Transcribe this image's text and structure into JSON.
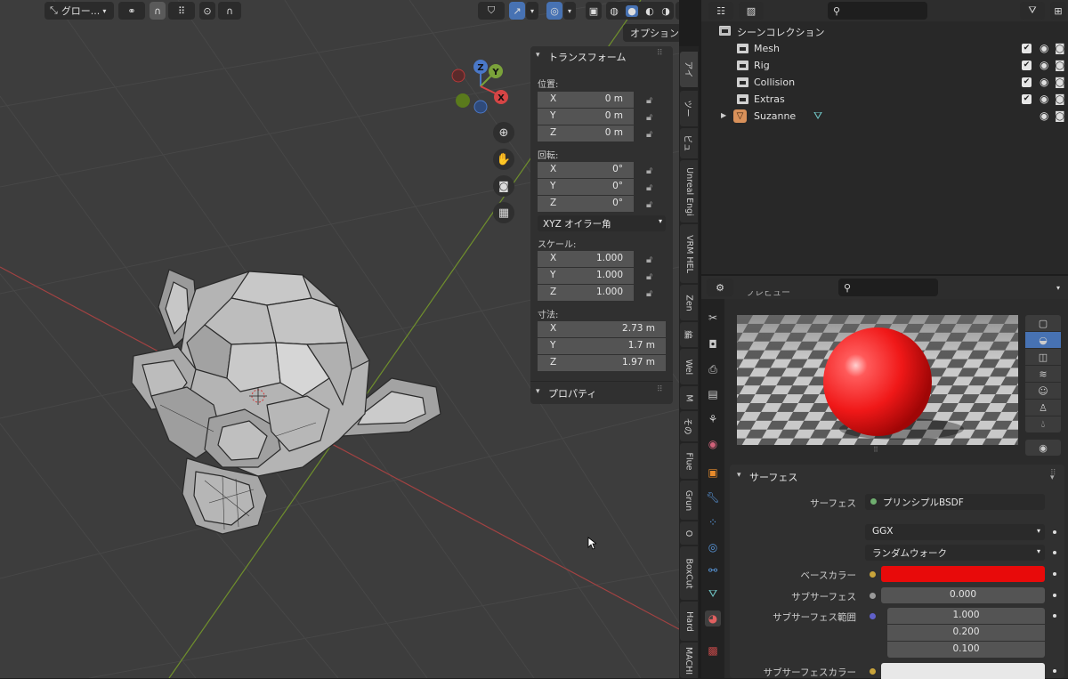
{
  "viewport": {
    "header": {
      "orientation_label": "グロー...",
      "options_label": "オプション"
    },
    "gizmo": {
      "z": "Z",
      "y": "Y",
      "x": "X"
    }
  },
  "npanel": {
    "transform_title": "トランスフォーム",
    "location_label": "位置:",
    "location": [
      {
        "axis": "X",
        "value": "0 m"
      },
      {
        "axis": "Y",
        "value": "0 m"
      },
      {
        "axis": "Z",
        "value": "0 m"
      }
    ],
    "rotation_label": "回転:",
    "rotation": [
      {
        "axis": "X",
        "value": "0°"
      },
      {
        "axis": "Y",
        "value": "0°"
      },
      {
        "axis": "Z",
        "value": "0°"
      }
    ],
    "rotation_mode": "XYZ オイラー角",
    "scale_label": "スケール:",
    "scale": [
      {
        "axis": "X",
        "value": "1.000"
      },
      {
        "axis": "Y",
        "value": "1.000"
      },
      {
        "axis": "Z",
        "value": "1.000"
      }
    ],
    "dimensions_label": "寸法:",
    "dimensions": [
      {
        "axis": "X",
        "value": "2.73 m"
      },
      {
        "axis": "Y",
        "value": "1.7 m"
      },
      {
        "axis": "Z",
        "value": "1.97 m"
      }
    ],
    "properties_title": "プロパティ"
  },
  "sidetabs": [
    "アイ",
    "ツー",
    "ビュ",
    "Unreal Engi",
    "VRM HEL",
    "Zen",
    "編",
    "Wel",
    "M",
    "その",
    "Flue",
    "Grun",
    "O",
    "BoxCut",
    "Hard",
    "MACHI"
  ],
  "outliner": {
    "scene_collection": "シーンコレクション",
    "items": [
      "Mesh",
      "Rig",
      "Collision",
      "Extras"
    ],
    "object": "Suzanne"
  },
  "properties": {
    "preview_title": "プレビュー",
    "surface_title": "サーフェス",
    "surface_label": "サーフェス",
    "surface_value": "プリンシプルBSDF",
    "distribution": "GGX",
    "subsurface_method": "ランダムウォーク",
    "base_color_label": "ベースカラー",
    "base_color": "#e80a0a",
    "subsurface_label": "サブサーフェス",
    "subsurface_value": "0.000",
    "subsurface_radius_label": "サブサーフェス範囲",
    "subsurface_radius": [
      "1.000",
      "0.200",
      "0.100"
    ],
    "subsurface_color_label": "サブサーフェスカラー"
  },
  "colors": {
    "accent": "#4772b3",
    "axis_red": "#b83838",
    "axis_green": "#7a9a2a",
    "panel": "#303030"
  }
}
